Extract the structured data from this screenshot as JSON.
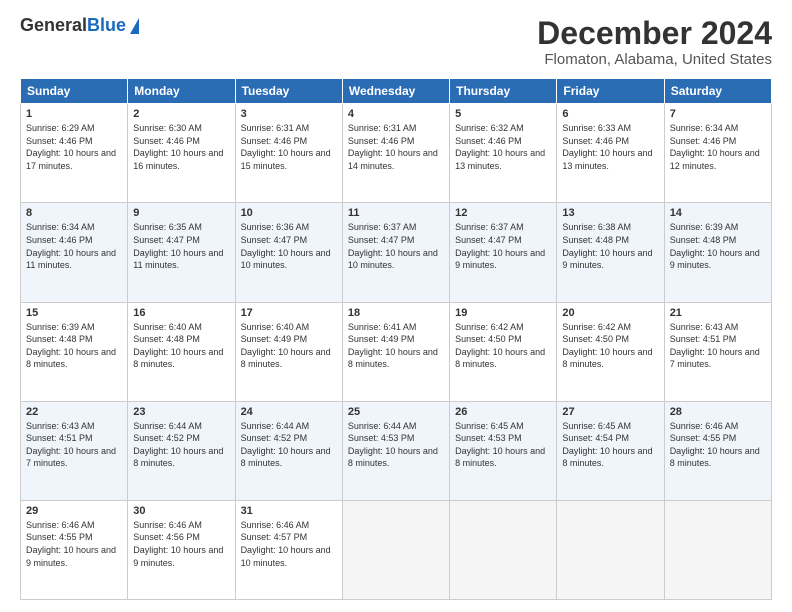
{
  "header": {
    "logo_general": "General",
    "logo_blue": "Blue",
    "title": "December 2024",
    "subtitle": "Flomaton, Alabama, United States"
  },
  "calendar": {
    "days": [
      "Sunday",
      "Monday",
      "Tuesday",
      "Wednesday",
      "Thursday",
      "Friday",
      "Saturday"
    ],
    "weeks": [
      [
        {
          "num": "1",
          "sunrise": "Sunrise: 6:29 AM",
          "sunset": "Sunset: 4:46 PM",
          "daylight": "Daylight: 10 hours and 17 minutes."
        },
        {
          "num": "2",
          "sunrise": "Sunrise: 6:30 AM",
          "sunset": "Sunset: 4:46 PM",
          "daylight": "Daylight: 10 hours and 16 minutes."
        },
        {
          "num": "3",
          "sunrise": "Sunrise: 6:31 AM",
          "sunset": "Sunset: 4:46 PM",
          "daylight": "Daylight: 10 hours and 15 minutes."
        },
        {
          "num": "4",
          "sunrise": "Sunrise: 6:31 AM",
          "sunset": "Sunset: 4:46 PM",
          "daylight": "Daylight: 10 hours and 14 minutes."
        },
        {
          "num": "5",
          "sunrise": "Sunrise: 6:32 AM",
          "sunset": "Sunset: 4:46 PM",
          "daylight": "Daylight: 10 hours and 13 minutes."
        },
        {
          "num": "6",
          "sunrise": "Sunrise: 6:33 AM",
          "sunset": "Sunset: 4:46 PM",
          "daylight": "Daylight: 10 hours and 13 minutes."
        },
        {
          "num": "7",
          "sunrise": "Sunrise: 6:34 AM",
          "sunset": "Sunset: 4:46 PM",
          "daylight": "Daylight: 10 hours and 12 minutes."
        }
      ],
      [
        {
          "num": "8",
          "sunrise": "Sunrise: 6:34 AM",
          "sunset": "Sunset: 4:46 PM",
          "daylight": "Daylight: 10 hours and 11 minutes."
        },
        {
          "num": "9",
          "sunrise": "Sunrise: 6:35 AM",
          "sunset": "Sunset: 4:47 PM",
          "daylight": "Daylight: 10 hours and 11 minutes."
        },
        {
          "num": "10",
          "sunrise": "Sunrise: 6:36 AM",
          "sunset": "Sunset: 4:47 PM",
          "daylight": "Daylight: 10 hours and 10 minutes."
        },
        {
          "num": "11",
          "sunrise": "Sunrise: 6:37 AM",
          "sunset": "Sunset: 4:47 PM",
          "daylight": "Daylight: 10 hours and 10 minutes."
        },
        {
          "num": "12",
          "sunrise": "Sunrise: 6:37 AM",
          "sunset": "Sunset: 4:47 PM",
          "daylight": "Daylight: 10 hours and 9 minutes."
        },
        {
          "num": "13",
          "sunrise": "Sunrise: 6:38 AM",
          "sunset": "Sunset: 4:48 PM",
          "daylight": "Daylight: 10 hours and 9 minutes."
        },
        {
          "num": "14",
          "sunrise": "Sunrise: 6:39 AM",
          "sunset": "Sunset: 4:48 PM",
          "daylight": "Daylight: 10 hours and 9 minutes."
        }
      ],
      [
        {
          "num": "15",
          "sunrise": "Sunrise: 6:39 AM",
          "sunset": "Sunset: 4:48 PM",
          "daylight": "Daylight: 10 hours and 8 minutes."
        },
        {
          "num": "16",
          "sunrise": "Sunrise: 6:40 AM",
          "sunset": "Sunset: 4:48 PM",
          "daylight": "Daylight: 10 hours and 8 minutes."
        },
        {
          "num": "17",
          "sunrise": "Sunrise: 6:40 AM",
          "sunset": "Sunset: 4:49 PM",
          "daylight": "Daylight: 10 hours and 8 minutes."
        },
        {
          "num": "18",
          "sunrise": "Sunrise: 6:41 AM",
          "sunset": "Sunset: 4:49 PM",
          "daylight": "Daylight: 10 hours and 8 minutes."
        },
        {
          "num": "19",
          "sunrise": "Sunrise: 6:42 AM",
          "sunset": "Sunset: 4:50 PM",
          "daylight": "Daylight: 10 hours and 8 minutes."
        },
        {
          "num": "20",
          "sunrise": "Sunrise: 6:42 AM",
          "sunset": "Sunset: 4:50 PM",
          "daylight": "Daylight: 10 hours and 8 minutes."
        },
        {
          "num": "21",
          "sunrise": "Sunrise: 6:43 AM",
          "sunset": "Sunset: 4:51 PM",
          "daylight": "Daylight: 10 hours and 7 minutes."
        }
      ],
      [
        {
          "num": "22",
          "sunrise": "Sunrise: 6:43 AM",
          "sunset": "Sunset: 4:51 PM",
          "daylight": "Daylight: 10 hours and 7 minutes."
        },
        {
          "num": "23",
          "sunrise": "Sunrise: 6:44 AM",
          "sunset": "Sunset: 4:52 PM",
          "daylight": "Daylight: 10 hours and 8 minutes."
        },
        {
          "num": "24",
          "sunrise": "Sunrise: 6:44 AM",
          "sunset": "Sunset: 4:52 PM",
          "daylight": "Daylight: 10 hours and 8 minutes."
        },
        {
          "num": "25",
          "sunrise": "Sunrise: 6:44 AM",
          "sunset": "Sunset: 4:53 PM",
          "daylight": "Daylight: 10 hours and 8 minutes."
        },
        {
          "num": "26",
          "sunrise": "Sunrise: 6:45 AM",
          "sunset": "Sunset: 4:53 PM",
          "daylight": "Daylight: 10 hours and 8 minutes."
        },
        {
          "num": "27",
          "sunrise": "Sunrise: 6:45 AM",
          "sunset": "Sunset: 4:54 PM",
          "daylight": "Daylight: 10 hours and 8 minutes."
        },
        {
          "num": "28",
          "sunrise": "Sunrise: 6:46 AM",
          "sunset": "Sunset: 4:55 PM",
          "daylight": "Daylight: 10 hours and 8 minutes."
        }
      ],
      [
        {
          "num": "29",
          "sunrise": "Sunrise: 6:46 AM",
          "sunset": "Sunset: 4:55 PM",
          "daylight": "Daylight: 10 hours and 9 minutes."
        },
        {
          "num": "30",
          "sunrise": "Sunrise: 6:46 AM",
          "sunset": "Sunset: 4:56 PM",
          "daylight": "Daylight: 10 hours and 9 minutes."
        },
        {
          "num": "31",
          "sunrise": "Sunrise: 6:46 AM",
          "sunset": "Sunset: 4:57 PM",
          "daylight": "Daylight: 10 hours and 10 minutes."
        },
        null,
        null,
        null,
        null
      ]
    ]
  }
}
